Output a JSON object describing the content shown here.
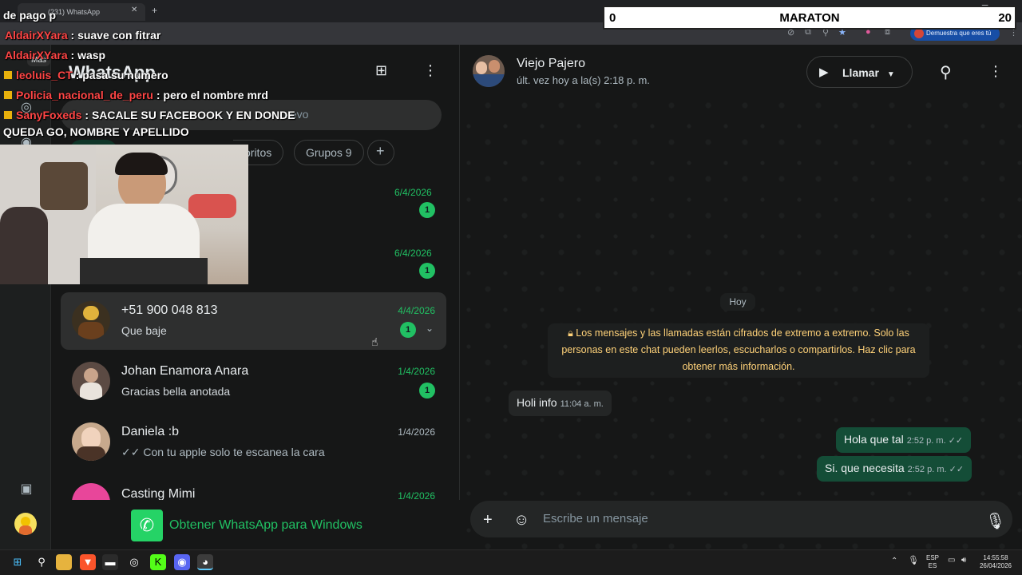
{
  "browser": {
    "tab_title": "(231) WhatsApp",
    "profile_label": "Demuestra que eres tú"
  },
  "overlay": {
    "score_left": "0",
    "score_title": "MARATON",
    "score_right": "20",
    "chat": [
      {
        "user": "",
        "text": "de pago p"
      },
      {
        "user": "AldairXYara",
        "text": "suave con fitrar"
      },
      {
        "user": "AldairXYara",
        "text": "wasp"
      },
      {
        "user": "leoluis_CT",
        "text": "pasa su numero"
      },
      {
        "user": "Policia_nacional_de_peru",
        "text": "pero el nombre mrd"
      },
      {
        "user": "SanyFoxeds",
        "text": "SACALE SU FACEBOOK Y EN DONDE"
      },
      {
        "user": "",
        "text": "QUEDA GO, NOMBRE Y APELLIDO"
      }
    ]
  },
  "rail": {
    "more_label": "Más"
  },
  "list": {
    "brand": "WhatsApp",
    "search_placeholder": "uevo",
    "chips": [
      "oritos",
      "Grupos 9"
    ],
    "partial_rows": [
      {
        "time": "6/4/2026",
        "unread": "1"
      },
      {
        "time": "6/4/2026",
        "unread": "1"
      }
    ],
    "rows": [
      {
        "name": "+51 900 048 813",
        "preview": "Que baje",
        "time": "4/4/2026",
        "unread": "1"
      },
      {
        "name": "Johan Enamora Anara",
        "preview": "Gracias bella anotada",
        "time": "1/4/2026",
        "unread": "1"
      },
      {
        "name": "Daniela :b",
        "preview": "✓✓ Con tu apple solo te escanea la cara",
        "time": "1/4/2026",
        "unread": ""
      },
      {
        "name": "Casting Mimi",
        "preview": "",
        "time": "1/4/2026",
        "unread": ""
      }
    ],
    "promo": "Obtener WhatsApp para Windows"
  },
  "chat": {
    "name": "Viejo Pajero",
    "status": "últ. vez hoy a la(s) 2:18 p. m.",
    "call_label": "Llamar",
    "day": "Hoy",
    "encryption_notice": "Los mensajes y las llamadas están cifrados de extremo a extremo. Solo las personas en este chat pueden leerlos, escucharlos o compartirlos. Haz clic para obtener más información.",
    "messages": [
      {
        "dir": "in",
        "text": "Holi info",
        "time": "11:04 a. m."
      },
      {
        "dir": "out",
        "text": "Hola que tal",
        "time": "2:52 p. m. ✓✓"
      },
      {
        "dir": "out",
        "text": "Si. que necesita",
        "time": "2:52 p. m. ✓✓"
      }
    ],
    "composer_placeholder": "Escribe un mensaje"
  },
  "taskbar": {
    "lang_top": "ESP",
    "lang_bottom": "ES",
    "clock_time": "14:55:58",
    "clock_date": "26/04/2026"
  }
}
